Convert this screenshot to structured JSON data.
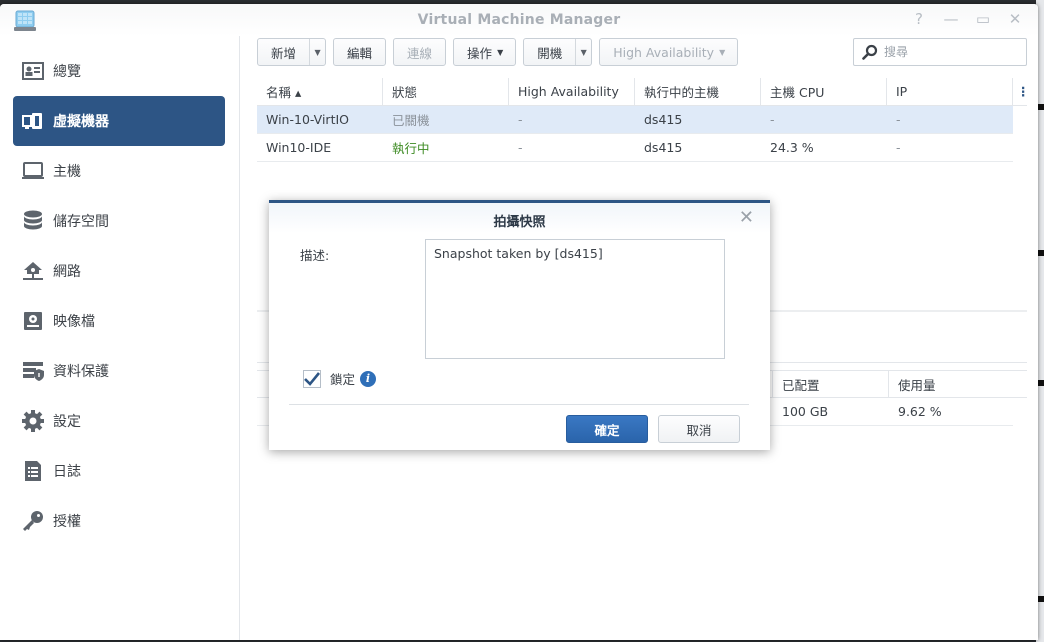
{
  "window": {
    "title": "Virtual Machine Manager",
    "controls": [
      "help-icon",
      "minimize-icon",
      "maximize-icon",
      "close-icon"
    ]
  },
  "sidebar": {
    "items": [
      {
        "label": "總覽",
        "icon": "overview-icon"
      },
      {
        "label": "虛擬機器",
        "icon": "virtual-machine-icon",
        "active": true
      },
      {
        "label": "主機",
        "icon": "host-icon"
      },
      {
        "label": "儲存空間",
        "icon": "storage-icon"
      },
      {
        "label": "網路",
        "icon": "network-icon"
      },
      {
        "label": "映像檔",
        "icon": "image-icon"
      },
      {
        "label": "資料保護",
        "icon": "data-protection-icon"
      },
      {
        "label": "設定",
        "icon": "settings-icon"
      },
      {
        "label": "日誌",
        "icon": "log-icon"
      },
      {
        "label": "授權",
        "icon": "license-key-icon"
      }
    ]
  },
  "toolbar": {
    "create_label": "新增",
    "edit_label": "編輯",
    "connect_label": "連線",
    "action_label": "操作",
    "power_on_label": "開機",
    "ha_label": "High Availability",
    "search_placeholder": "搜尋"
  },
  "vm_table": {
    "columns": [
      "名稱 ▴",
      "狀態",
      "High Availability",
      "執行中的主機",
      "主機 CPU",
      "IP"
    ],
    "rows": [
      {
        "name": "Win-10-VirtIO",
        "status": "已關機",
        "ha": "-",
        "host": "ds415",
        "cpu": "-",
        "ip": "-",
        "selected": true
      },
      {
        "name": "Win10-IDE",
        "status": "執行中",
        "ha": "-",
        "host": "ds415",
        "cpu": "24.3 %",
        "ip": "-"
      }
    ]
  },
  "disk_table": {
    "columns": [
      "已配置",
      "使用量"
    ],
    "rows": [
      {
        "allocated": "100 GB",
        "usage": "9.62 %"
      }
    ]
  },
  "dialog": {
    "title": "拍攝快照",
    "description_label": "描述:",
    "description_value": "Snapshot taken by [ds415]",
    "lock_label": "鎖定",
    "lock_checked": true,
    "ok_label": "確定",
    "cancel_label": "取消"
  },
  "colors": {
    "accent": "#2d5585",
    "running": "#3d8b23",
    "selected_row": "#dfeaf8",
    "primary_button": "#2f6fb8"
  }
}
